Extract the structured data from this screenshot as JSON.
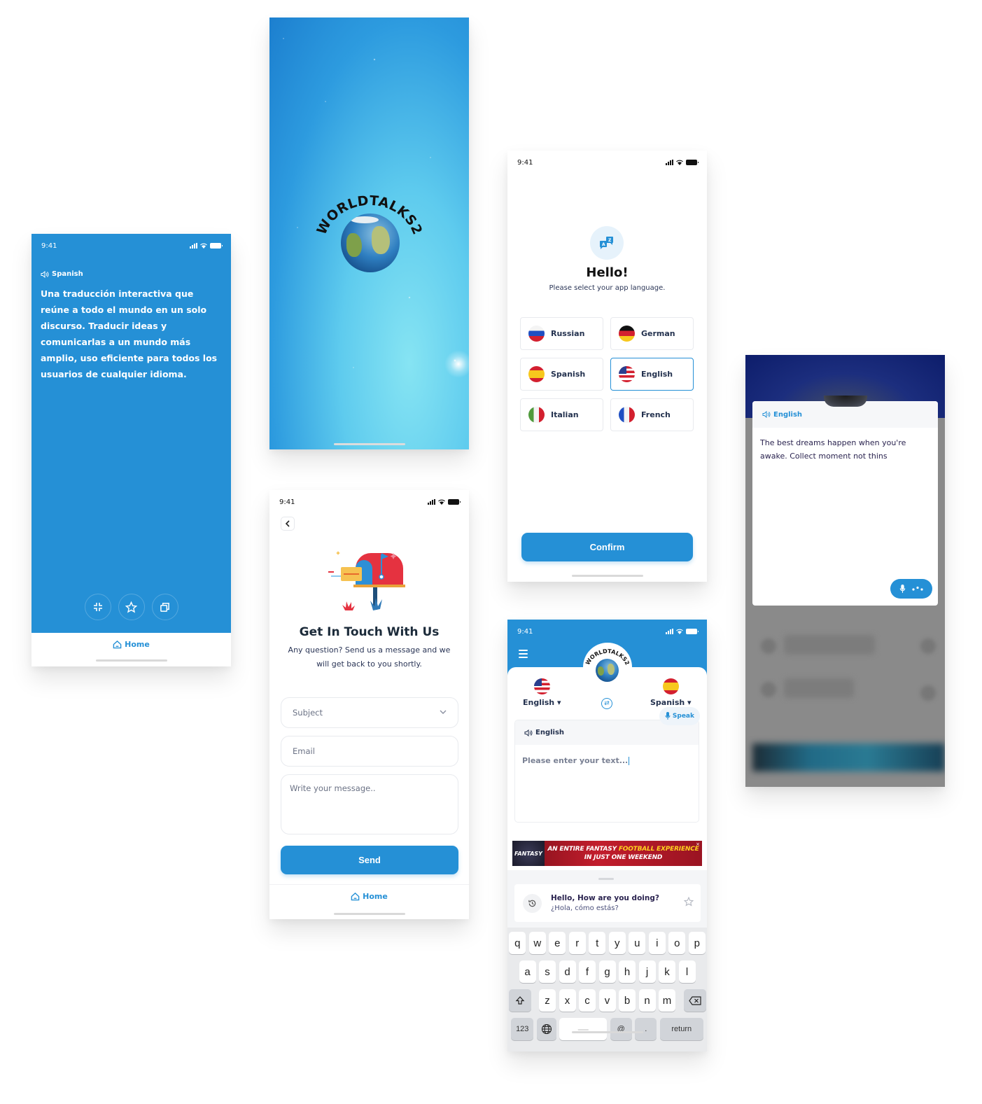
{
  "common": {
    "status_time": "9:41",
    "home_label": "Home",
    "accent_color": "#2590d6"
  },
  "reader_screen": {
    "language": "Spanish",
    "text": "Una traducción interactiva que reúne a todo el mundo en un solo discurso. Traducir ideas y comunicarlas a un mundo más amplio, uso eficiente para todos los usuarios de cualquier idioma.",
    "actions": [
      {
        "icon": "collapse-icon"
      },
      {
        "icon": "star-icon"
      },
      {
        "icon": "copy-icon"
      }
    ]
  },
  "splash_screen": {
    "logo_text": "WORLDTALKS2"
  },
  "language_screen": {
    "title": "Hello!",
    "subtitle": "Please select your app language.",
    "languages": [
      {
        "label": "Russian",
        "flag": "russia",
        "selected": false
      },
      {
        "label": "German",
        "flag": "germany",
        "selected": false
      },
      {
        "label": "Spanish",
        "flag": "spain",
        "selected": false
      },
      {
        "label": "English",
        "flag": "usa",
        "selected": true
      },
      {
        "label": "Italian",
        "flag": "italy",
        "selected": false
      },
      {
        "label": "French",
        "flag": "france",
        "selected": false
      }
    ],
    "confirm_label": "Confirm"
  },
  "contact_screen": {
    "title": "Get In Touch With Us",
    "subtitle": "Any question? Send us a message and we will get back to you shortly.",
    "subject_placeholder": "Subject",
    "email_placeholder": "Email",
    "message_placeholder": "Write your message..",
    "send_label": "Send"
  },
  "translator_screen": {
    "logo_text": "WORLDTALKS2",
    "source_language": "English",
    "target_language": "Spanish",
    "input_language_label": "English",
    "input_placeholder": "Please enter your text...",
    "speak_label": "Speak",
    "ad": {
      "badge": "FANTASY",
      "line1_white": "AN ENTIRE FANTASY ",
      "line1_yellow": "FOOTBALL EXPERIENCE",
      "line2": "IN JUST ONE WEEKEND",
      "close": "×"
    },
    "history": [
      {
        "source": "Hello, How are you doing?",
        "translation": "¿Hola, cómo estás?"
      }
    ],
    "keyboard": {
      "row1": [
        "q",
        "w",
        "e",
        "r",
        "t",
        "y",
        "u",
        "i",
        "o",
        "p"
      ],
      "row2": [
        "a",
        "s",
        "d",
        "f",
        "g",
        "h",
        "j",
        "k",
        "l"
      ],
      "row3": [
        "z",
        "x",
        "c",
        "v",
        "b",
        "n",
        "m"
      ],
      "numbers_label": "123",
      "at_label": "@",
      "dot_label": ".",
      "return_label": "return"
    }
  },
  "listening_screen": {
    "language": "English",
    "text": "The best dreams happen when you're awake. Collect moment not thins"
  }
}
